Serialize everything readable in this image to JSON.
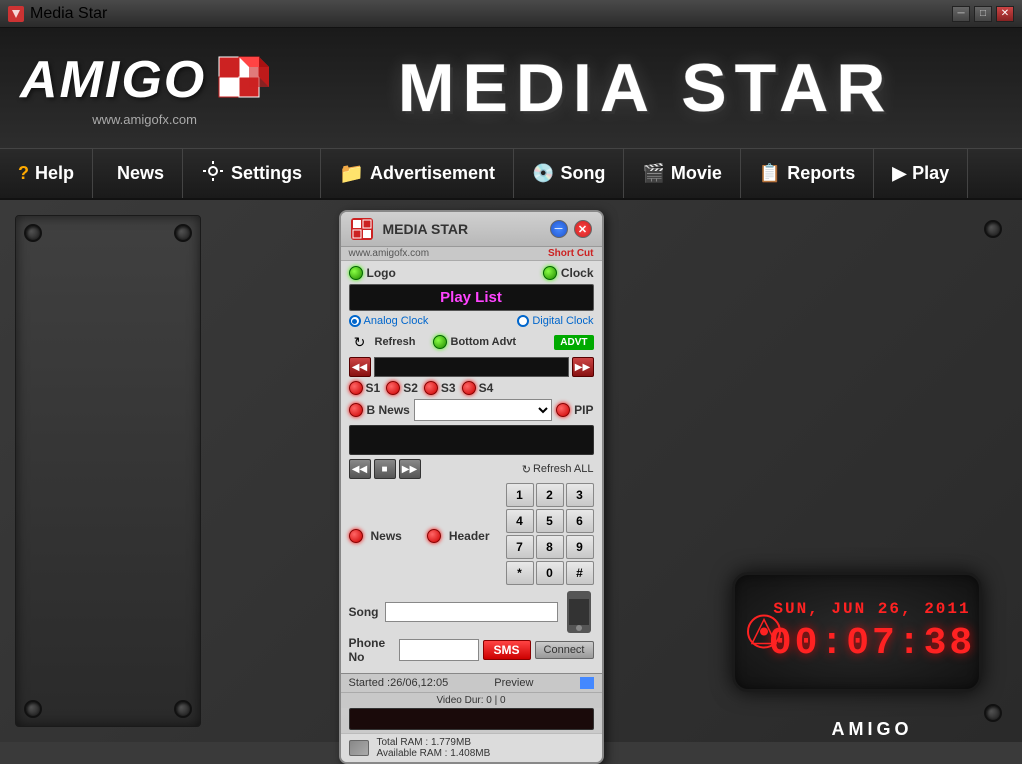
{
  "titleBar": {
    "title": "Media Star",
    "minLabel": "─",
    "maxLabel": "□",
    "closeLabel": "✕"
  },
  "header": {
    "logoText": "AMIGO",
    "logoSub": "www.amigofx.com",
    "title": "MEDIA STAR"
  },
  "nav": {
    "items": [
      {
        "label": "Help",
        "icon": "help-icon"
      },
      {
        "label": "News",
        "icon": "news-icon"
      },
      {
        "label": "Settings",
        "icon": "settings-icon"
      },
      {
        "label": "Advertisement",
        "icon": "advertisement-icon"
      },
      {
        "label": "Song",
        "icon": "song-icon"
      },
      {
        "label": "Movie",
        "icon": "movie-icon"
      },
      {
        "label": "Reports",
        "icon": "reports-icon"
      },
      {
        "label": "Play",
        "icon": "play-icon"
      }
    ]
  },
  "widget": {
    "title": "MEDIA STAR",
    "url": "www.amigofx.com",
    "shortcut": "Short Cut",
    "logo_label": "Logo",
    "clock_label": "Clock",
    "playlist_label": "Play List",
    "analog_clock": "Analog Clock",
    "digital_clock": "Digital Clock",
    "refresh_label": "Refresh",
    "bottom_advt": "Bottom Advt",
    "advt_btn": "ADVT",
    "s1": "S1",
    "s2": "S2",
    "s3": "S3",
    "s4": "S4",
    "b_news": "B  News",
    "pip": "PIP",
    "refresh_all": "Refresh ALL",
    "news_label": "News",
    "header_label": "Header",
    "song_label": "Song",
    "phone_label": "Phone No",
    "sms_btn": "SMS",
    "connect_btn": "Connect",
    "started": "Started :26/06,12:05",
    "preview": "Preview",
    "video_dur": "Video Dur: 0 | 0",
    "total_ram": "Total RAM :",
    "total_ram_val": "1.779MB",
    "available_ram": "Available RAM :",
    "available_ram_val": "1.408MB",
    "numpad": [
      "1",
      "2",
      "3",
      "4",
      "5",
      "6",
      "7",
      "8",
      "9",
      "*",
      "0",
      "#"
    ]
  },
  "clock": {
    "date": "SUN, JUN 26, 2011",
    "time": "00:07:38",
    "brand": "AMIGO"
  }
}
